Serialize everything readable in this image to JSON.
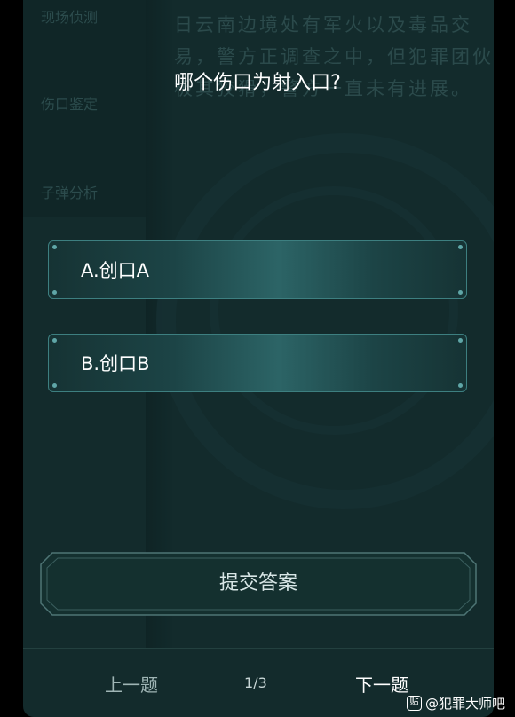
{
  "background": {
    "nav_items": [
      "现场侦测",
      "伤口鉴定",
      "子弹分析"
    ],
    "text_lines": [
      "日云南边境处有军火以及毒品交",
      "易，警方正调查之中，但犯罪团伙",
      "极其狡猾，警方一直未有进展。"
    ]
  },
  "quiz": {
    "question": "哪个伤口为射入口?",
    "options": [
      {
        "label": "A.创口A"
      },
      {
        "label": "B.创口B"
      }
    ],
    "submit_label": "提交答案"
  },
  "pagination": {
    "prev_label": "上一题",
    "counter": "1/3",
    "next_label": "下一题"
  },
  "watermark": {
    "icon_glyph": "贴",
    "text": "@犯罪大师吧"
  },
  "colors": {
    "panel": "#132b2c",
    "option_border": "#3d7f80",
    "option_glow": "#2c6466"
  }
}
